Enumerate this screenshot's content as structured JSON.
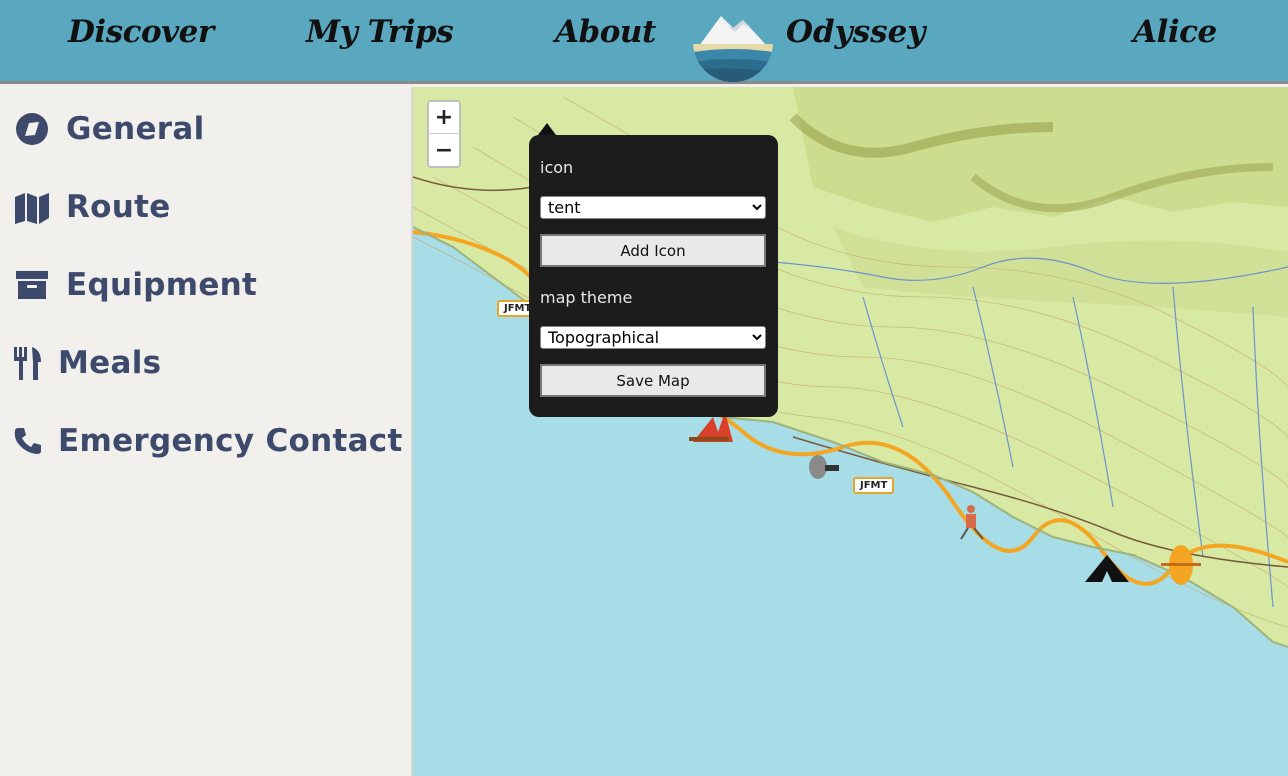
{
  "nav": {
    "discover": "Discover",
    "my_trips": "My Trips",
    "about": "About",
    "brand": "Odyssey",
    "user": "Alice"
  },
  "sidebar": {
    "items": [
      {
        "label": "General",
        "icon": "compass-icon"
      },
      {
        "label": "Route",
        "icon": "map-icon"
      },
      {
        "label": "Equipment",
        "icon": "archive-box-icon"
      },
      {
        "label": "Meals",
        "icon": "utensils-icon"
      },
      {
        "label": "Emergency Contact",
        "icon": "phone-icon"
      }
    ]
  },
  "map": {
    "zoom_in": "+",
    "zoom_out": "−",
    "trail_shield": "JFMT",
    "panel": {
      "icon_label": "icon",
      "icon_selected": "tent",
      "add_icon_button": "Add Icon",
      "theme_label": "map theme",
      "theme_selected": "Topographical",
      "save_map_button": "Save Map"
    }
  },
  "colors": {
    "nav_bg": "#5aa8bf",
    "sidebar_text": "#3d4a6b",
    "water": "#a6dde6",
    "land": "#d8e9a4",
    "trail": "#f4a623"
  }
}
